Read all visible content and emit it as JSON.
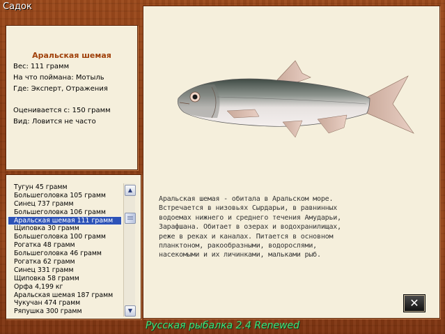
{
  "window": {
    "title": "Садок"
  },
  "fish_info": {
    "name": "Аральская шемая",
    "weight": "Вес: 111 грамм",
    "bait": "На что поймана: Мотыль",
    "location": "Где: Эксперт, Отражения",
    "valued_from": "Оценивается с: 150 грамм",
    "frequency": "Вид: Ловится не часто"
  },
  "catch_list": {
    "items": [
      "Тугун 45 грамм",
      "Большеголовка 105 грамм",
      "Синец 737 грамм",
      "Большеголовка 106 грамм",
      "Аральская шемая 111 грамм",
      "Щиповка 30 грамм",
      "Большеголовка 100 грамм",
      "Рогатка 48 грамм",
      "Большеголовка 46 грамм",
      "Рогатка 62 грамм",
      "Синец 331 грамм",
      "Щиповка 58 грамм",
      "Орфа 4,199 кг",
      "Аральская шемая 187 грамм",
      "Чукучан 474 грамм",
      "Ряпушка 300 грамм"
    ],
    "selected_index": 4
  },
  "description": "Аральская шемая - обитала в Аральском море. Встречается в низовьях Сырдарьи, в равнинных водоемах нижнего и среднего течения Амударьи, Зарафшана. Обитает в озерах и водохранилищах, реже в реках и каналах. Питается в основном планктоном, ракообразными, водорослями, насекомыми и их личинками, мальками рыб.",
  "close_icon": "close-x-icon",
  "footer": {
    "text": "Русская рыбалка 2.4 Renewed"
  }
}
